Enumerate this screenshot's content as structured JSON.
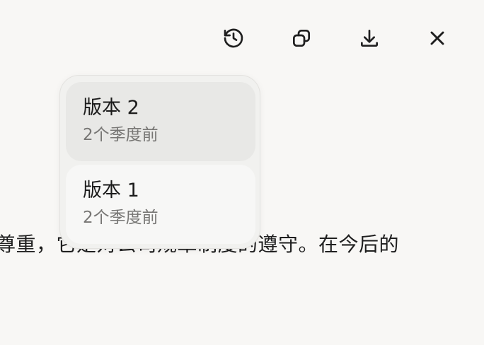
{
  "toolbar": {
    "icons": [
      "history-icon",
      "copy-icon",
      "download-icon",
      "close-icon"
    ]
  },
  "document": {
    "visible_line": "尊重，它是对公司规章制度的遵守。在今后的"
  },
  "version_menu": {
    "items": [
      {
        "name": "版本 2",
        "time": "2个季度前",
        "selected": true
      },
      {
        "name": "版本 1",
        "time": "2个季度前",
        "selected": false
      }
    ]
  },
  "colors": {
    "page_background": "#f8f7f5",
    "menu_background": "#f1f1ef",
    "selected_item": "#e8e8e6",
    "secondary_text": "#777674"
  }
}
